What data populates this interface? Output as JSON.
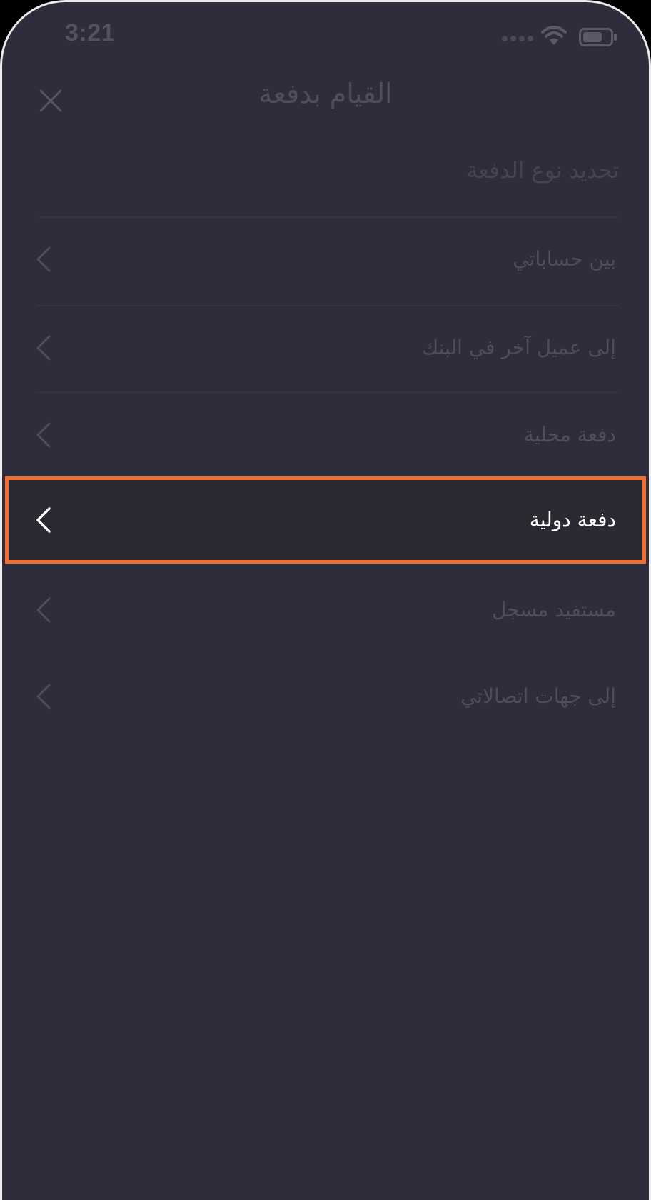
{
  "status_bar": {
    "time": "3:21",
    "icons": [
      "signal-dots-icon",
      "wifi-icon",
      "battery-icon"
    ]
  },
  "header": {
    "title": "القيام بدفعة",
    "close_icon": "close-icon"
  },
  "section": {
    "heading": "تحديد نوع الدفعة"
  },
  "payment_types": [
    {
      "label": "بين حساباتي",
      "icon": "chevron-left-icon"
    },
    {
      "label": "إلى عميل آخر في البنك",
      "icon": "chevron-left-icon"
    },
    {
      "label": "دفعة محلية",
      "icon": "chevron-left-icon"
    },
    {
      "label": "دفعة دولية",
      "icon": "chevron-left-icon",
      "selected": true
    },
    {
      "label": "مستفيد مسجل",
      "icon": "chevron-left-icon"
    },
    {
      "label": "إلى جهات اتصالاتي",
      "icon": "chevron-left-icon"
    }
  ],
  "colors": {
    "background": "#2d2d3b",
    "highlight_border": "#f36d2e",
    "selected_text": "#ffffff",
    "dim_text": "#4e4e5a"
  }
}
